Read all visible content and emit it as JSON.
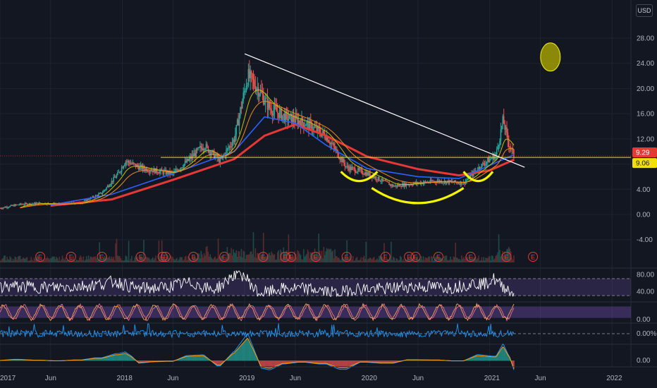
{
  "currency_label": "USD",
  "colors": {
    "background": "#131722",
    "grid": "#1f2330",
    "candle_up": "#26a69a",
    "candle_down": "#ef5350",
    "ema_fast": "#c8c400",
    "ema_mid": "#f28a1d",
    "ema_slow": "#2962ff",
    "ema_long": "#e53935",
    "horizontal_line": "#f0e000",
    "trendline": "#ffffff",
    "annotation_yellow": "#f5f500",
    "rsi_line": "#ffffff",
    "rsi_band": "#7e57c2",
    "stoch_k": "#ef6c8a",
    "stoch_d": "#f7a35c",
    "osc_line": "#2196f3",
    "earnings_marker": "#e53935",
    "price_label_red": "#e53935",
    "price_label_yellow": "#f0e000"
  },
  "price_labels": {
    "last": "9.29",
    "level": "9.06"
  },
  "earnings_marker_label": "E",
  "earnings_marker_count": 20,
  "chart_data": [
    {
      "type": "candlestick",
      "panel": "price",
      "title": "",
      "x_tick_labels": [
        "2017",
        "Jun",
        "2018",
        "Jun",
        "2019",
        "Jun",
        "2020",
        "Jun",
        "2021",
        "Jun",
        "2022"
      ],
      "y_tick_labels": [
        "28.00",
        "24.00",
        "20.00",
        "16.00",
        "12.00",
        "8.00",
        "4.00",
        "0.00",
        "-4.00"
      ],
      "y_ticks": [
        28,
        24,
        20,
        16,
        12,
        8,
        4,
        0,
        -4
      ],
      "ylim": [
        -6,
        31
      ],
      "xlim": [
        "2017-01-01",
        "2022-03-15"
      ],
      "approx_close": [
        {
          "x": "2017-01-01",
          "y": 1.0
        },
        {
          "x": "2017-03-01",
          "y": 1.6
        },
        {
          "x": "2017-05-01",
          "y": 1.8
        },
        {
          "x": "2017-07-01",
          "y": 1.6
        },
        {
          "x": "2017-09-01",
          "y": 1.9
        },
        {
          "x": "2017-11-01",
          "y": 3.4
        },
        {
          "x": "2017-12-20",
          "y": 6.5
        },
        {
          "x": "2018-01-10",
          "y": 8.5
        },
        {
          "x": "2018-02-20",
          "y": 7.5
        },
        {
          "x": "2018-04-01",
          "y": 7.0
        },
        {
          "x": "2018-06-01",
          "y": 6.5
        },
        {
          "x": "2018-07-15",
          "y": 8.5
        },
        {
          "x": "2018-09-01",
          "y": 11.0
        },
        {
          "x": "2018-10-20",
          "y": 8.5
        },
        {
          "x": "2018-12-01",
          "y": 12.0
        },
        {
          "x": "2019-01-10",
          "y": 22.0
        },
        {
          "x": "2019-02-10",
          "y": 20.0
        },
        {
          "x": "2019-03-15",
          "y": 17.0
        },
        {
          "x": "2019-05-01",
          "y": 15.5
        },
        {
          "x": "2019-07-01",
          "y": 14.5
        },
        {
          "x": "2019-09-01",
          "y": 12.5
        },
        {
          "x": "2019-11-01",
          "y": 7.5
        },
        {
          "x": "2020-01-01",
          "y": 6.5
        },
        {
          "x": "2020-03-20",
          "y": 4.5
        },
        {
          "x": "2020-06-01",
          "y": 5.0
        },
        {
          "x": "2020-08-01",
          "y": 5.3
        },
        {
          "x": "2020-10-15",
          "y": 5.0
        },
        {
          "x": "2020-12-01",
          "y": 7.5
        },
        {
          "x": "2021-01-20",
          "y": 9.5
        },
        {
          "x": "2021-02-10",
          "y": 15.0
        },
        {
          "x": "2021-02-25",
          "y": 11.5
        },
        {
          "x": "2021-03-15",
          "y": 9.29
        }
      ],
      "series": [
        {
          "color_key": "ema_long",
          "values": [
            {
              "x": "2017-06-01",
              "y": 1.4
            },
            {
              "x": "2017-12-01",
              "y": 2.4
            },
            {
              "x": "2018-06-01",
              "y": 5.5
            },
            {
              "x": "2018-12-01",
              "y": 8.8
            },
            {
              "x": "2019-03-01",
              "y": 12.5
            },
            {
              "x": "2019-06-01",
              "y": 14.3
            },
            {
              "x": "2019-09-01",
              "y": 12.5
            },
            {
              "x": "2020-01-01",
              "y": 9.2
            },
            {
              "x": "2020-06-01",
              "y": 7.2
            },
            {
              "x": "2020-10-01",
              "y": 6.2
            },
            {
              "x": "2021-01-01",
              "y": 7.0
            },
            {
              "x": "2021-03-15",
              "y": 8.7
            }
          ]
        },
        {
          "color_key": "ema_slow",
          "values": [
            {
              "x": "2017-06-01",
              "y": 1.5
            },
            {
              "x": "2017-12-01",
              "y": 3.2
            },
            {
              "x": "2018-06-01",
              "y": 6.5
            },
            {
              "x": "2018-12-01",
              "y": 10.0
            },
            {
              "x": "2019-03-01",
              "y": 15.5
            },
            {
              "x": "2019-06-01",
              "y": 14.5
            },
            {
              "x": "2019-09-01",
              "y": 11.0
            },
            {
              "x": "2020-01-01",
              "y": 7.3
            },
            {
              "x": "2020-06-01",
              "y": 6.0
            },
            {
              "x": "2020-10-01",
              "y": 5.7
            },
            {
              "x": "2021-01-01",
              "y": 7.8
            },
            {
              "x": "2021-03-15",
              "y": 9.5
            }
          ]
        }
      ],
      "annotations": {
        "horizontal_level": 9.06,
        "trendline": [
          {
            "x": "2019-01-01",
            "y": 25.5
          },
          {
            "x": "2021-04-15",
            "y": 7.5
          }
        ],
        "arcs": [
          {
            "from": {
              "x": "2019-10-15",
              "y": 6.8
            },
            "to": {
              "x": "2020-02-01",
              "y": 6.8
            },
            "bottom": 5.3
          },
          {
            "from": {
              "x": "2020-01-15",
              "y": 4.2
            },
            "to": {
              "x": "2020-10-15",
              "y": 4.2
            },
            "bottom": 1.8
          },
          {
            "from": {
              "x": "2020-10-15",
              "y": 6.8
            },
            "to": {
              "x": "2021-01-10",
              "y": 6.8
            },
            "bottom": 5.3
          }
        ],
        "circle": {
          "x": "2021-07-01",
          "y": 25.0
        }
      }
    },
    {
      "type": "line",
      "panel": "rsi",
      "y_tick_labels": [
        "80.00",
        "40.00"
      ],
      "y_ticks": [
        80,
        40
      ],
      "band": [
        30,
        70
      ],
      "ylim": [
        15,
        95
      ]
    },
    {
      "type": "line",
      "panel": "stochastic",
      "y_tick_labels": [
        "0.00"
      ],
      "y_ticks": [
        0
      ],
      "band": [
        20,
        80
      ],
      "ylim": [
        0,
        100
      ]
    },
    {
      "type": "line",
      "panel": "oscillator",
      "y_tick_labels": [
        "0.00%"
      ],
      "y_ticks": [
        0
      ]
    },
    {
      "type": "histogram",
      "panel": "macd",
      "y_tick_labels": [
        "0.00"
      ],
      "y_ticks": [
        0
      ]
    }
  ]
}
